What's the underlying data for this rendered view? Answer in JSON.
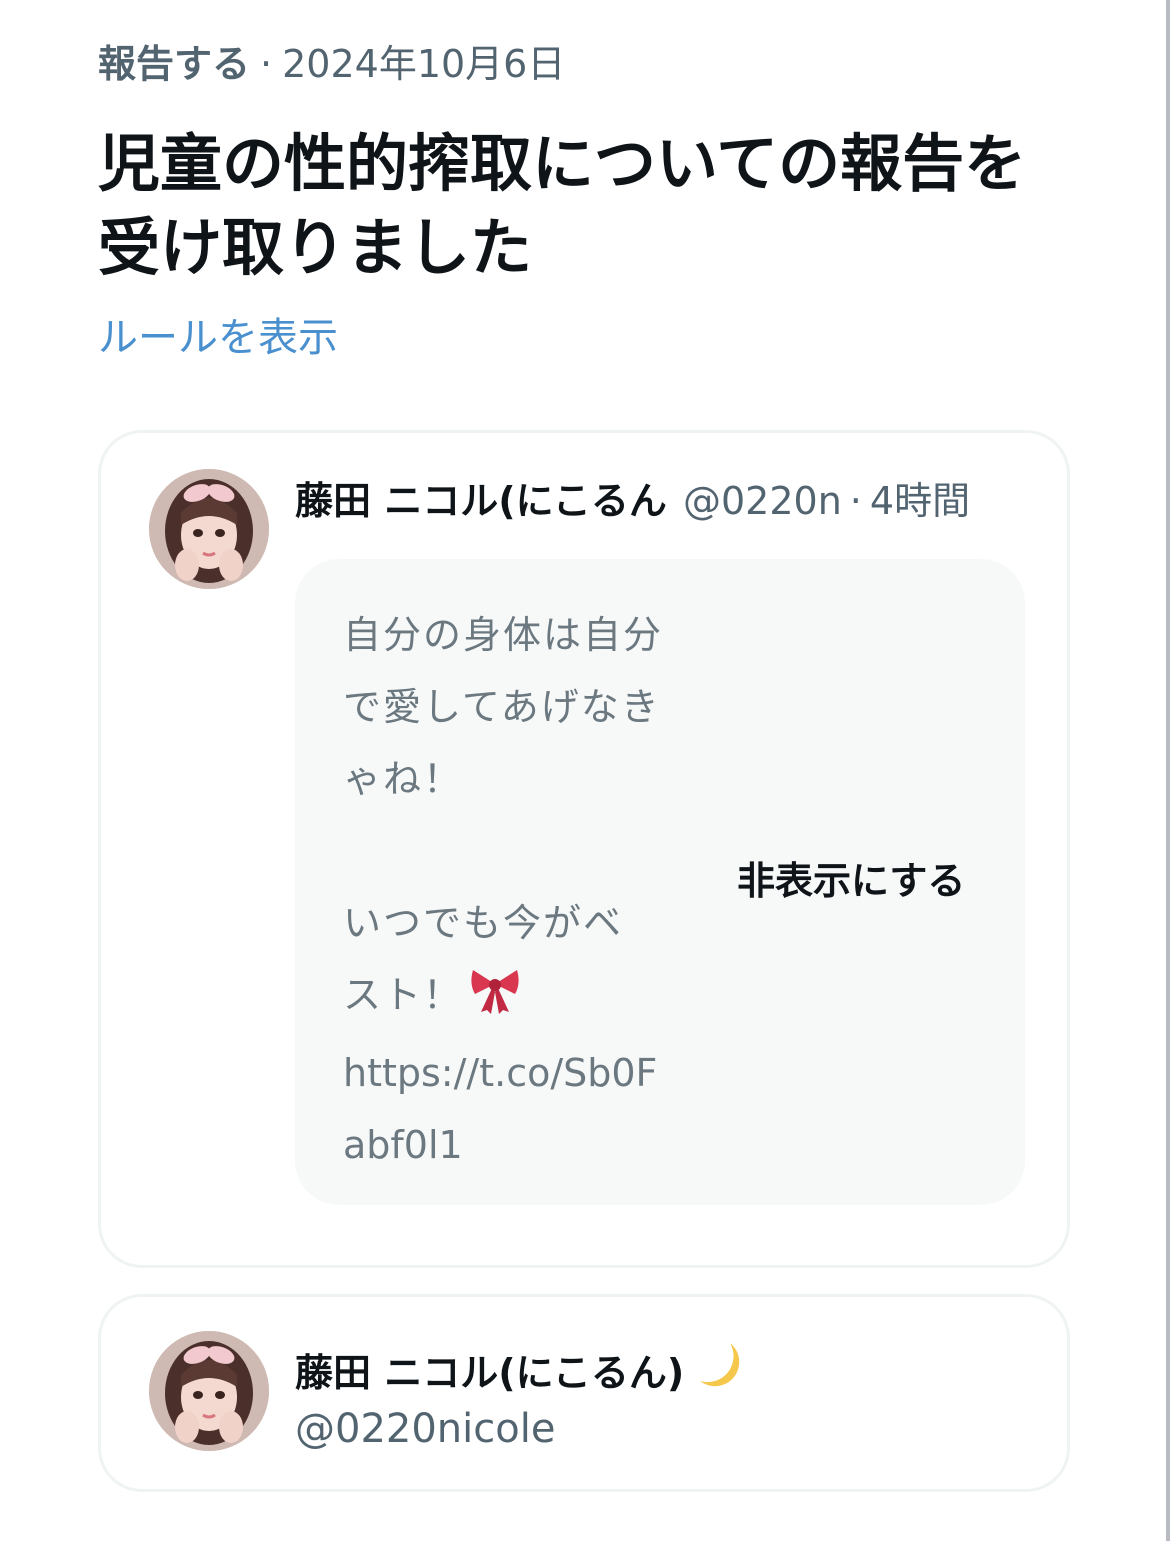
{
  "report": {
    "kind_label": "報告する",
    "separator": "·",
    "date": "2024年10月6日",
    "title": "児童の性的搾取についての報告を受け取りました",
    "rules_link": "ルールを表示"
  },
  "reported_post": {
    "avatar_icon": "profile-photo-avatar",
    "author_name": "藤田 ニコル(にこるん)",
    "handle": "@0220n",
    "separator": "·",
    "time": "4時間",
    "text": "自分の身体は自分で愛してあげなきゃね！\n\nいつでも今がベスト！",
    "emoji_icon": "ribbon-icon",
    "link": "https://t.co/Sb0Fabf0l1",
    "hide_label": "非表示にする",
    "body_background": "#f7f9f9"
  },
  "reported_account": {
    "avatar_icon": "profile-photo-avatar",
    "display_name": "藤田 ニコル(にこるん)",
    "emoji_icon": "crescent-moon-icon",
    "handle": "@0220nicole"
  },
  "colors": {
    "text_primary": "#0f1419",
    "text_secondary": "#536471",
    "link": "#4a90cf",
    "card_border": "#eff3f4"
  }
}
